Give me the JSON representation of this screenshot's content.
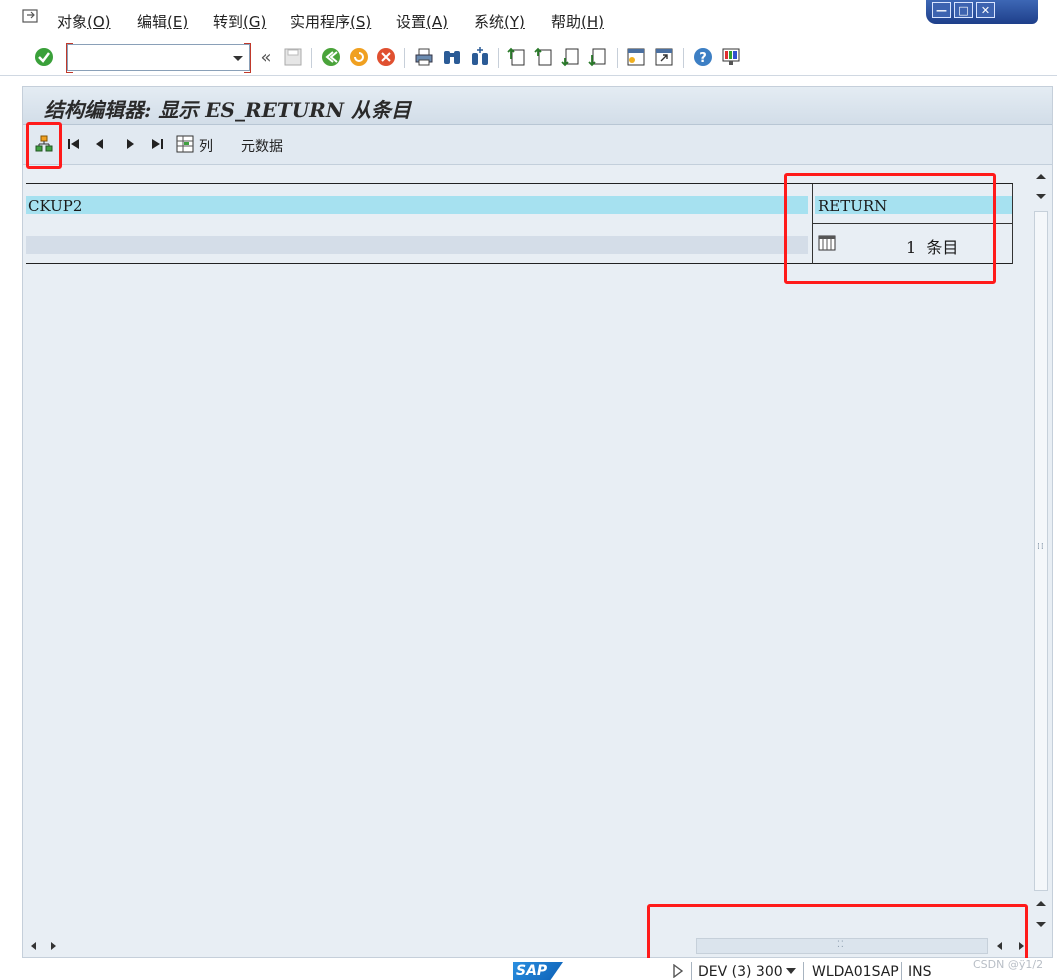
{
  "menubar": {
    "items": [
      {
        "label": "对象",
        "key": "(O)"
      },
      {
        "label": "编辑",
        "key": "(E)"
      },
      {
        "label": "转到",
        "key": "(G)"
      },
      {
        "label": "实用程序",
        "key": "(S)"
      },
      {
        "label": "设置",
        "key": "(A)"
      },
      {
        "label": "系统",
        "key": "(Y)"
      },
      {
        "label": "帮助",
        "key": "(H)"
      }
    ]
  },
  "window_controls": {
    "minimize": "—",
    "maximize": "□",
    "close": "✕"
  },
  "toolbar": {
    "command_value": "",
    "history_glyph": "«"
  },
  "screen": {
    "title": "结构编辑器: 显示 ES_RETURN 从条目"
  },
  "app_toolbar": {
    "columns_label": "列",
    "metadata_label": "元数据"
  },
  "grid": {
    "row1_left": "CKUP2",
    "row1_right": "RETURN",
    "row2_count": "1",
    "row2_unit": "条目"
  },
  "statusbar": {
    "logo": "SAP",
    "system": "DEV (3) 300",
    "server": "WLDA01SAP",
    "mode": "INS",
    "watermark": "CSDN @ÿ1/2"
  },
  "colors": {
    "highlight": "#ff1a1a",
    "selected_row": "#a6e1f0",
    "background": "#e8eef4"
  }
}
